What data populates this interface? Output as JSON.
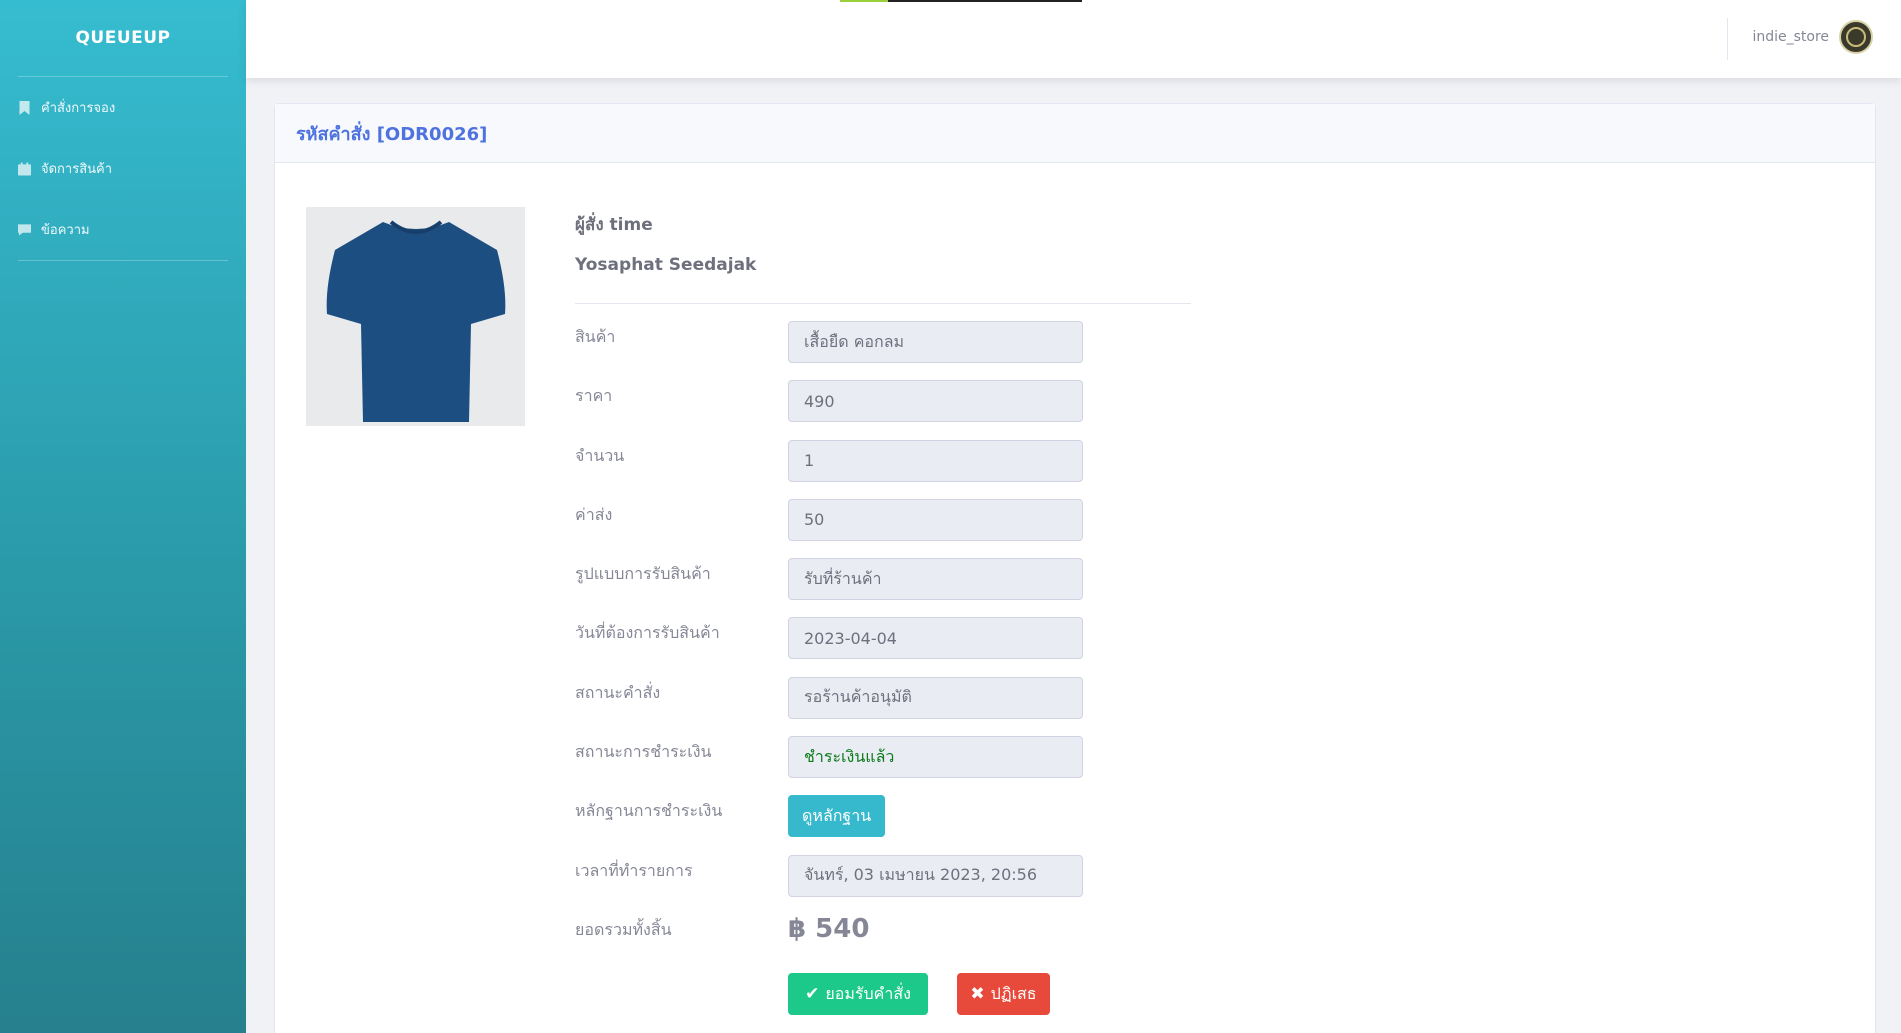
{
  "sidebar": {
    "brand": "QUEUEUP",
    "items": [
      {
        "label": "คำสั่งการจอง",
        "icon": "bookmark-icon"
      },
      {
        "label": "จัดการสินค้า",
        "icon": "calendar-icon"
      },
      {
        "label": "ข้อความ",
        "icon": "comment-icon"
      }
    ]
  },
  "topbar": {
    "username": "indie_store",
    "avatar_icon": "store-logo-avatar"
  },
  "card": {
    "title": "รหัสคำสั่ง [ODR0026]",
    "product_image_icon": "tshirt-image",
    "orderer_label": "ผู้สั่ง time",
    "orderer_name": "Yosaphat Seedajak",
    "fields": [
      {
        "label": "สินค้า",
        "value": "เสื้อยืด คอกลม"
      },
      {
        "label": "ราคา",
        "value": "490"
      },
      {
        "label": "จำนวน",
        "value": "1"
      },
      {
        "label": "ค่าส่ง",
        "value": "50"
      },
      {
        "label": "รูปแบบการรับสินค้า",
        "value": "รับที่ร้านค้า"
      },
      {
        "label": "วันที่ต้องการรับสินค้า",
        "value": "2023-04-04"
      },
      {
        "label": "สถานะคำสั่ง",
        "value": "รอร้านค้าอนุมัติ"
      },
      {
        "label": "สถานะการชำระเงิน",
        "value": "ชำระเงินแล้ว"
      },
      {
        "label": "หลักฐานการชำระเงิน",
        "value": "ดูหลักฐาน"
      },
      {
        "label": "เวลาที่ทำรายการ",
        "value": "จันทร์, 03 เมษายน 2023, 20:56"
      },
      {
        "label": "ยอดรวมทั้งสิ้น",
        "value": "฿ 540"
      }
    ],
    "accept_label": "ยอมรับคำสั่ง",
    "reject_label": "ปฏิเสธ"
  },
  "colors": {
    "accent": "#4e73df",
    "info": "#36b9cc",
    "success": "#1cc88a",
    "danger": "#e74a3b",
    "paid_text": "#0a7a1a"
  }
}
